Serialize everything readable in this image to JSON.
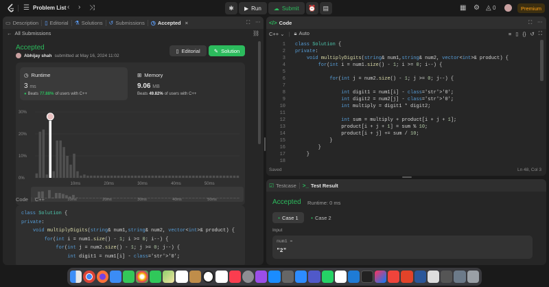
{
  "topbar": {
    "title": "Problem List",
    "run": "Run",
    "submit": "Submit",
    "streak": "0",
    "premium": "Premium"
  },
  "left": {
    "tabs": [
      "Description",
      "Editorial",
      "Solutions",
      "Submissions",
      "Accepted"
    ],
    "back": "All Submissions",
    "status": "Accepted",
    "user": "Abhijay shah",
    "submitted": "submitted at May 16, 2024 11:02",
    "editorial_btn": "Editorial",
    "solution_btn": "Solution",
    "runtime_label": "Runtime",
    "runtime_value": "3",
    "runtime_unit": "ms",
    "runtime_beats_prefix": "Beats",
    "runtime_beats": "77.88%",
    "runtime_beats_suffix": "of users with C++",
    "memory_label": "Memory",
    "memory_value": "9.06",
    "memory_unit": "MB",
    "memory_beats_prefix": "Beats",
    "memory_beats": "49.82%",
    "memory_beats_suffix": "of users with C++",
    "code_label": "Code",
    "code_lang": "C++"
  },
  "chart_data": {
    "type": "bar",
    "ylabels": [
      "30%",
      "20%",
      "10%",
      "0%"
    ],
    "xlabels": [
      "10ms",
      "20ms",
      "30ms",
      "40ms",
      "50ms"
    ],
    "mini_xlabels": [
      "10ms",
      "20ms",
      "30ms",
      "40ms",
      "50ms"
    ],
    "ylim": [
      0,
      30
    ],
    "values": [
      2,
      21,
      22,
      1.5,
      26,
      3,
      17,
      17,
      14,
      10,
      6,
      11,
      3,
      1,
      1.5,
      1,
      1,
      1,
      1,
      1,
      1,
      1,
      1,
      1,
      1,
      1,
      1,
      1,
      1,
      1,
      1,
      1,
      1,
      1,
      1,
      1,
      1,
      1,
      1,
      1,
      1,
      1,
      1,
      1,
      1,
      1,
      1,
      1,
      1,
      1,
      1,
      1,
      1,
      1,
      1,
      1,
      1,
      1,
      1,
      1
    ],
    "highlight_index": 4,
    "colors": {
      "bar": "#505050",
      "highlight": "#ffffff"
    }
  },
  "left_code": [
    "class Solution {",
    "private:",
    "    void multiplyDigits(string& num1,string& num2, vector<int>& product) {",
    "        for(int i = num1.size() - 1; i >= 0; i--) {",
    "",
    "            for(int j = num2.size() - 1; j >= 0; j--) {",
    "",
    "                int digit1 = num1[i] - '0';"
  ],
  "right": {
    "tab_code": "Code",
    "lang": "C++",
    "auto": "Auto",
    "saved": "Saved",
    "cursor": "Ln 48, Col 3",
    "line_numbers": [
      "1",
      "2",
      "3",
      "4",
      "5",
      "6",
      "7",
      "8",
      "9",
      "10",
      "11",
      "12",
      "13",
      "14",
      "15",
      "16",
      "17",
      "18"
    ],
    "code": [
      "class Solution {",
      "private:",
      "    void multiplyDigits(string& num1,string& num2, vector<int>& product) {",
      "        for(int i = num1.size() - 1; i >= 0; i--) {",
      "",
      "            for(int j = num2.size() - 1; j >= 0; j--) {",
      "",
      "                int digit1 = num1[i] - '0';",
      "                int digit2 = num2[j] - '0';",
      "                int multiply = digit1 * digit2;",
      "",
      "                int sum = multiply + product[i + j + 1];",
      "                product[i + j + 1] = sum % 10;",
      "                product[i + j] += sum / 10;",
      "            }",
      "        }",
      "    }",
      ""
    ],
    "tab_testcase": "Testcase",
    "tab_result": "Test Result",
    "result_status": "Accepted",
    "result_runtime": "Runtime: 0 ms",
    "case1": "Case 1",
    "case2": "Case 2",
    "input_label": "Input",
    "input_name": "num1 =",
    "input_value": "\"2\""
  }
}
